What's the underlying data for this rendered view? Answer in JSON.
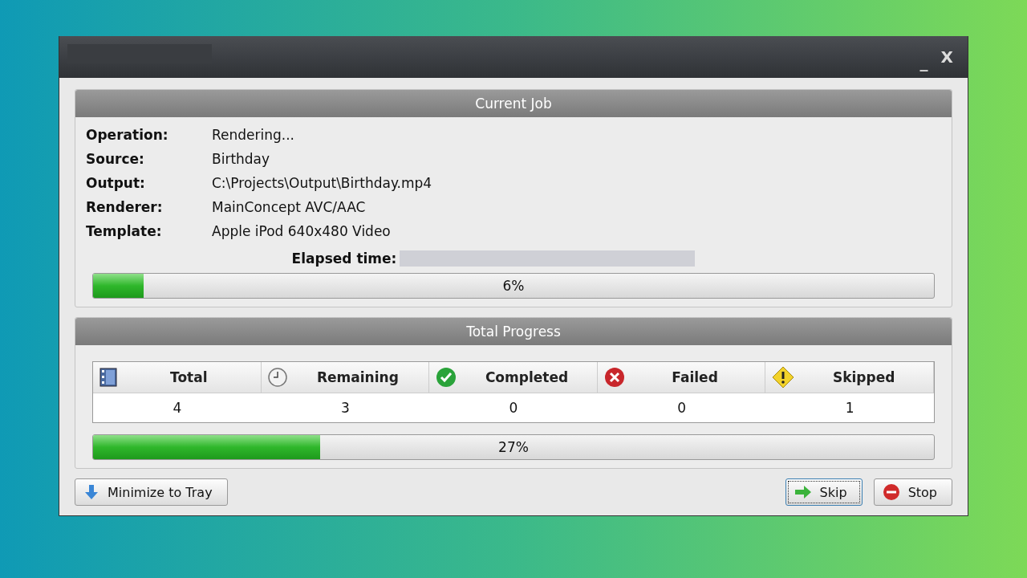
{
  "window": {
    "controls": [
      {
        "kind": "minimize",
        "label": "_"
      },
      {
        "kind": "close",
        "label": "X"
      }
    ]
  },
  "current_job": {
    "title": "Current Job",
    "fields": [
      {
        "label": "Operation:",
        "value": "Rendering..."
      },
      {
        "label": "Source:",
        "value": "Birthday"
      },
      {
        "label": "Output:",
        "value": "C:\\Projects\\Output\\Birthday.mp4"
      },
      {
        "label": "Renderer:",
        "value": "MainConcept AVC/AAC"
      },
      {
        "label": "Template:",
        "value": "Apple iPod 640x480 Video"
      }
    ],
    "elapsed_label": "Elapsed time:",
    "progress": {
      "level": 0.06,
      "text": "6%"
    }
  },
  "total_progress": {
    "title": "Total Progress",
    "columns": [
      {
        "kind": "total",
        "label": "Total",
        "value": "4"
      },
      {
        "kind": "remaining",
        "label": "Remaining",
        "value": "3"
      },
      {
        "kind": "completed",
        "label": "Completed",
        "value": "0"
      },
      {
        "kind": "failed",
        "label": "Failed",
        "value": "0"
      },
      {
        "kind": "skipped",
        "label": "Skipped",
        "value": "1"
      }
    ],
    "progress": {
      "level": 0.27,
      "text": "27%"
    }
  },
  "buttons": [
    {
      "kind": "tray",
      "label": "Minimize to Tray",
      "focused": false
    },
    {
      "kind": "skip",
      "label": "Skip",
      "focused": true
    },
    {
      "kind": "stop",
      "label": "Stop",
      "focused": false
    }
  ]
}
